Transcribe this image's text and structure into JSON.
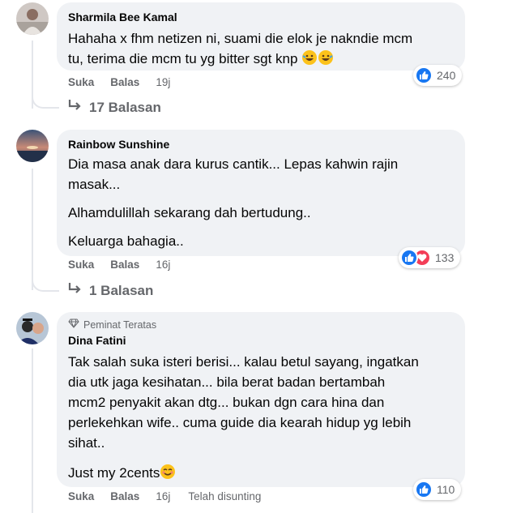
{
  "comments": [
    {
      "author": "Sharmila Bee Kamal",
      "lines": [
        "Hahaha x fhm netizen ni, suami die elok je nakndie mcm",
        "tu, terima die mcm tu yg bitter sgt knp"
      ],
      "like": "Suka",
      "reply": "Balas",
      "time": "19j",
      "reaction_count": "240",
      "reactions": [
        "like-icon"
      ],
      "replies_label": "17 Balasan"
    },
    {
      "author": "Rainbow Sunshine",
      "paragraphs": [
        "Dia masa anak dara kurus cantik... Lepas kahwin rajin",
        "masak...",
        "Alhamdulillah sekarang dah bertudung..",
        "Keluarga bahagia.."
      ],
      "like": "Suka",
      "reply": "Balas",
      "time": "16j",
      "reaction_count": "133",
      "reactions": [
        "like-icon",
        "love-icon"
      ],
      "replies_label": "1 Balasan"
    },
    {
      "badge": "Peminat Teratas",
      "author": "Dina Fatini",
      "lines": [
        "Tak salah suka isteri berisi... kalau betul sayang, ingatkan",
        "dia utk jaga kesihatan... bila berat badan bertambah",
        "mcm2 penyakit akan dtg... bukan dgn cara hina dan",
        "perlekehkan wife.. cuma guide dia kearah hidup yg lebih",
        "sihat.."
      ],
      "last_line": "Just my 2cents",
      "like": "Suka",
      "reply": "Balas",
      "time": "16j",
      "edited": "Telah disunting",
      "reaction_count": "110",
      "reactions": [
        "like-icon"
      ]
    }
  ],
  "colors": {
    "like_blue": "#1877f2",
    "love_red": "#f33e58",
    "bubble": "#f0f2f5",
    "muted": "#65676b"
  }
}
